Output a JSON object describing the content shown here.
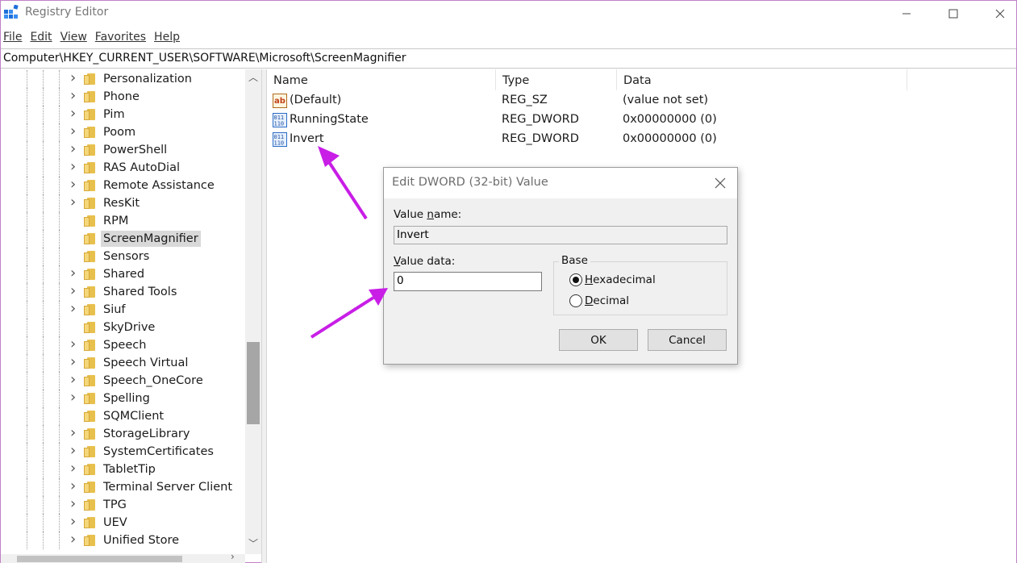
{
  "window": {
    "title": "Registry Editor",
    "icon": "registry-editor-icon"
  },
  "menu": [
    {
      "label": "File"
    },
    {
      "label": "Edit"
    },
    {
      "label": "View"
    },
    {
      "label": "Favorites"
    },
    {
      "label": "Help"
    }
  ],
  "address": {
    "path": "Computer\\HKEY_CURRENT_USER\\SOFTWARE\\Microsoft\\ScreenMagnifier"
  },
  "tree": {
    "items": [
      {
        "label": "Personalization",
        "expandable": true,
        "selected": false
      },
      {
        "label": "Phone",
        "expandable": true,
        "selected": false
      },
      {
        "label": "Pim",
        "expandable": true,
        "selected": false
      },
      {
        "label": "Poom",
        "expandable": true,
        "selected": false
      },
      {
        "label": "PowerShell",
        "expandable": true,
        "selected": false
      },
      {
        "label": "RAS AutoDial",
        "expandable": true,
        "selected": false
      },
      {
        "label": "Remote Assistance",
        "expandable": true,
        "selected": false
      },
      {
        "label": "ResKit",
        "expandable": true,
        "selected": false
      },
      {
        "label": "RPM",
        "expandable": false,
        "selected": false
      },
      {
        "label": "ScreenMagnifier",
        "expandable": false,
        "selected": true
      },
      {
        "label": "Sensors",
        "expandable": false,
        "selected": false
      },
      {
        "label": "Shared",
        "expandable": true,
        "selected": false
      },
      {
        "label": "Shared Tools",
        "expandable": true,
        "selected": false
      },
      {
        "label": "Siuf",
        "expandable": true,
        "selected": false
      },
      {
        "label": "SkyDrive",
        "expandable": false,
        "selected": false
      },
      {
        "label": "Speech",
        "expandable": true,
        "selected": false
      },
      {
        "label": "Speech Virtual",
        "expandable": true,
        "selected": false
      },
      {
        "label": "Speech_OneCore",
        "expandable": true,
        "selected": false
      },
      {
        "label": "Spelling",
        "expandable": true,
        "selected": false
      },
      {
        "label": "SQMClient",
        "expandable": false,
        "selected": false
      },
      {
        "label": "StorageLibrary",
        "expandable": true,
        "selected": false
      },
      {
        "label": "SystemCertificates",
        "expandable": true,
        "selected": false
      },
      {
        "label": "TabletTip",
        "expandable": true,
        "selected": false
      },
      {
        "label": "Terminal Server Client",
        "expandable": true,
        "selected": false
      },
      {
        "label": "TPG",
        "expandable": true,
        "selected": false
      },
      {
        "label": "UEV",
        "expandable": true,
        "selected": false
      },
      {
        "label": "Unified Store",
        "expandable": true,
        "selected": false
      }
    ]
  },
  "list": {
    "columns": {
      "name": "Name",
      "type": "Type",
      "data": "Data"
    },
    "rows": [
      {
        "name": "(Default)",
        "type": "REG_SZ",
        "data": "(value not set)",
        "icon": "string-value-icon"
      },
      {
        "name": "RunningState",
        "type": "REG_DWORD",
        "data": "0x00000000 (0)",
        "icon": "binary-value-icon"
      },
      {
        "name": "Invert",
        "type": "REG_DWORD",
        "data": "0x00000000 (0)",
        "icon": "binary-value-icon"
      }
    ]
  },
  "dialog": {
    "title": "Edit DWORD (32-bit) Value",
    "value_name_label_pre": "Value ",
    "value_name_label_u": "n",
    "value_name_label_post": "ame:",
    "value_name": "Invert",
    "value_data_label_pre": "",
    "value_data_label_u": "V",
    "value_data_label_post": "alue data:",
    "value_data": "0",
    "base_title": "Base",
    "hex_u": "H",
    "hex_rest": "exadecimal",
    "dec_u": "D",
    "dec_rest": "ecimal",
    "hex_checked": true,
    "ok_label": "OK",
    "cancel_label": "Cancel"
  },
  "colors": {
    "annotation_arrow": "#c81ee6",
    "folder": "#e8c04d",
    "selection": "#d9d9d9"
  }
}
